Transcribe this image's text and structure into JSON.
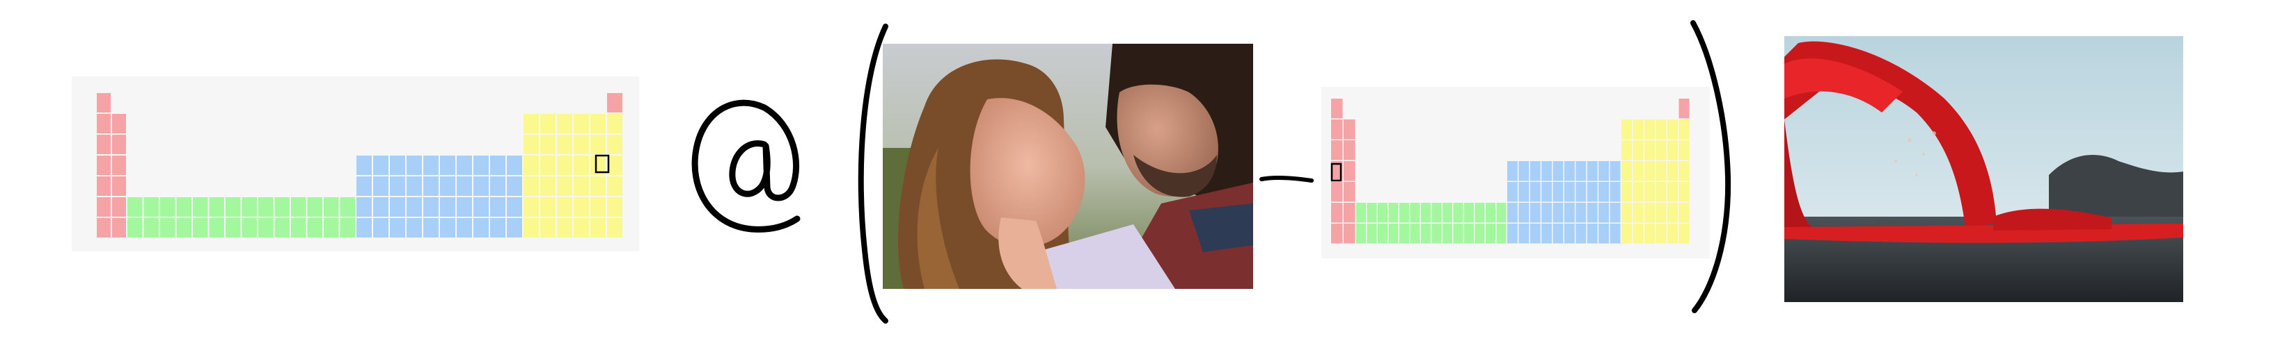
{
  "puzzle": {
    "operator_at": "@",
    "operator_minus": "−"
  },
  "periodic_table_1": {
    "highlighted_block": "p",
    "marked_cell": {
      "row": 3,
      "col": 16
    }
  },
  "periodic_table_2": {
    "marked_cell": {
      "row": 3,
      "col": 1
    }
  },
  "images": {
    "couple_photo": "couple-kissing-photo",
    "lava_photo": "lava-fountain-photo"
  },
  "colors": {
    "s_block": "#f5a3a5",
    "d_block": "#a7cff7",
    "p_block": "#fbf88d",
    "f_block": "#a3f79c",
    "table_bg": "#f6f6f6",
    "ink": "#000000"
  }
}
